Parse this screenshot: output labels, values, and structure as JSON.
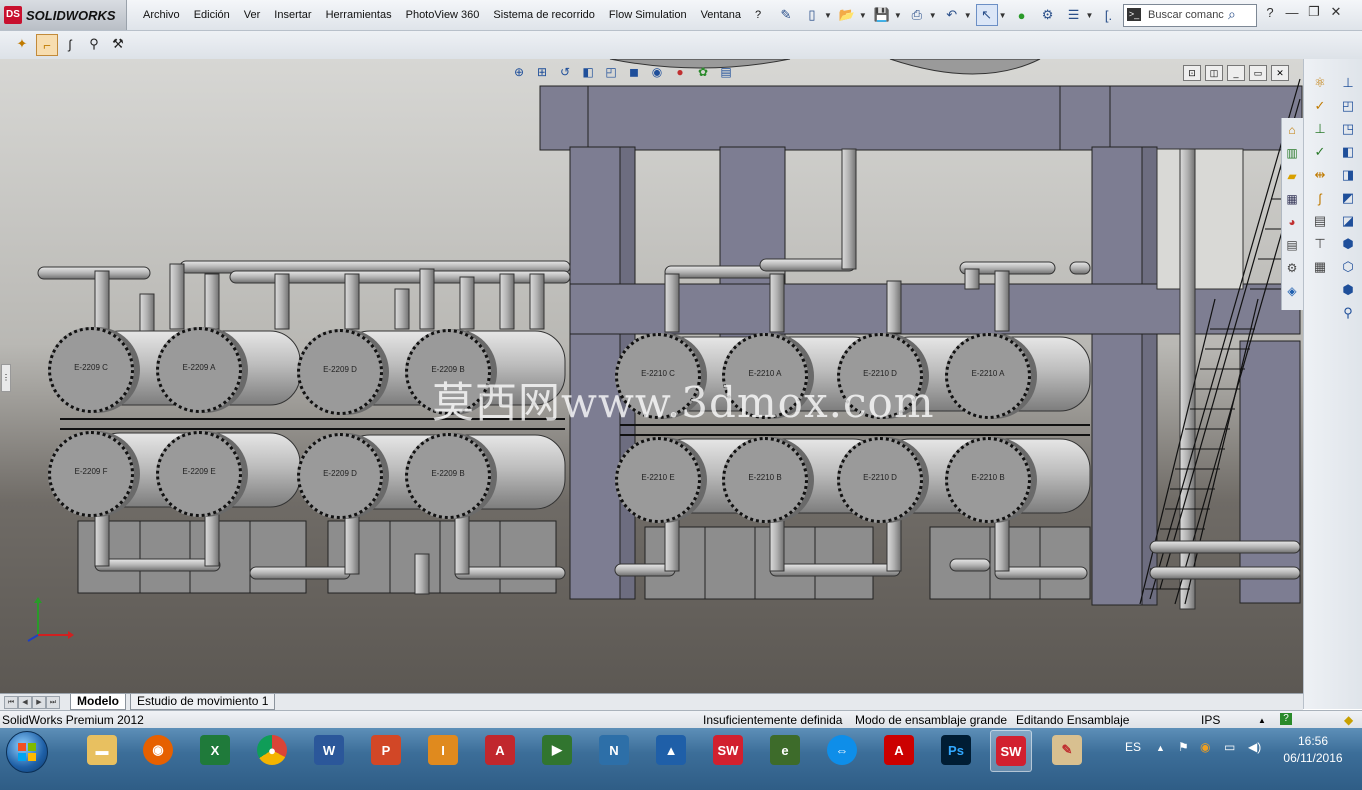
{
  "app": {
    "name": "SOLIDWORKS",
    "logo_mark": "DS"
  },
  "menu": [
    "Archivo",
    "Edición",
    "Ver",
    "Insertar",
    "Herramientas",
    "PhotoView 360",
    "Sistema de recorrido",
    "Flow Simulation",
    "Ventana",
    "?"
  ],
  "quick_access_icons": [
    "pin-icon",
    "new-document-icon",
    "open-icon",
    "save-icon",
    "print-icon",
    "undo-icon",
    "select-icon",
    "traffic-light-icon",
    "options-icon",
    "more-icon"
  ],
  "search": {
    "placeholder": "Buscar comanc",
    "icon_text": ">_"
  },
  "window_controls": [
    "?",
    "—",
    "❐",
    "✕"
  ],
  "viewport": {
    "watermark": "莫西网www.3dmox.com",
    "heads_up_icons": [
      "zoom-to-fit-icon",
      "zoom-area-icon",
      "previous-view-icon",
      "section-view-icon",
      "view-orientation-icon",
      "display-style-icon",
      "hide-show-icon",
      "appearance-icon",
      "scene-icon",
      "view-settings-icon"
    ],
    "colors": {
      "background_top": "#d7d7d4",
      "floor": "#5c5853",
      "steel": "#7d7d92",
      "vessel": "#a8a8a8"
    }
  },
  "exchangers_top_row": [
    "E-2209 C",
    "E-2209 A",
    "E-2209 D",
    "E-2209 B",
    "E-2210 C",
    "E-2210 A",
    "E-2210 D",
    "E-2210 A"
  ],
  "exchangers_bottom_row": [
    "E-2209 F",
    "E-2209 E",
    "E-2209 D",
    "E-2209 B",
    "E-2210 E",
    "E-2210 B",
    "E-2210 D",
    "E-2210 B"
  ],
  "task_pane_icons": [
    "home-icon",
    "design-library-icon",
    "file-explorer-icon",
    "view-palette-icon",
    "appearances-icon",
    "custom-properties-icon",
    "routing-library-icon",
    "3d-content-icon"
  ],
  "tabs": {
    "model": "Modelo",
    "motion": "Estudio de movimiento 1"
  },
  "status": {
    "product": "SolidWorks Premium 2012",
    "definition": "Insuficientemente definida",
    "mode": "Modo de ensamblaje grande",
    "editing": "Editando Ensamblaje",
    "units": "IPS",
    "help": "?"
  },
  "taskbar": {
    "apps": [
      "explorer",
      "firefox",
      "excel",
      "chrome",
      "word",
      "powerpoint",
      "inventor",
      "autocad",
      "project",
      "navisworks",
      "revit",
      "solidworks",
      "edge-animate",
      "teamviewer",
      "acrobat",
      "photoshop",
      "solidworks",
      "paint"
    ],
    "language": "ES",
    "time": "16:56",
    "date": "06/11/2016"
  }
}
